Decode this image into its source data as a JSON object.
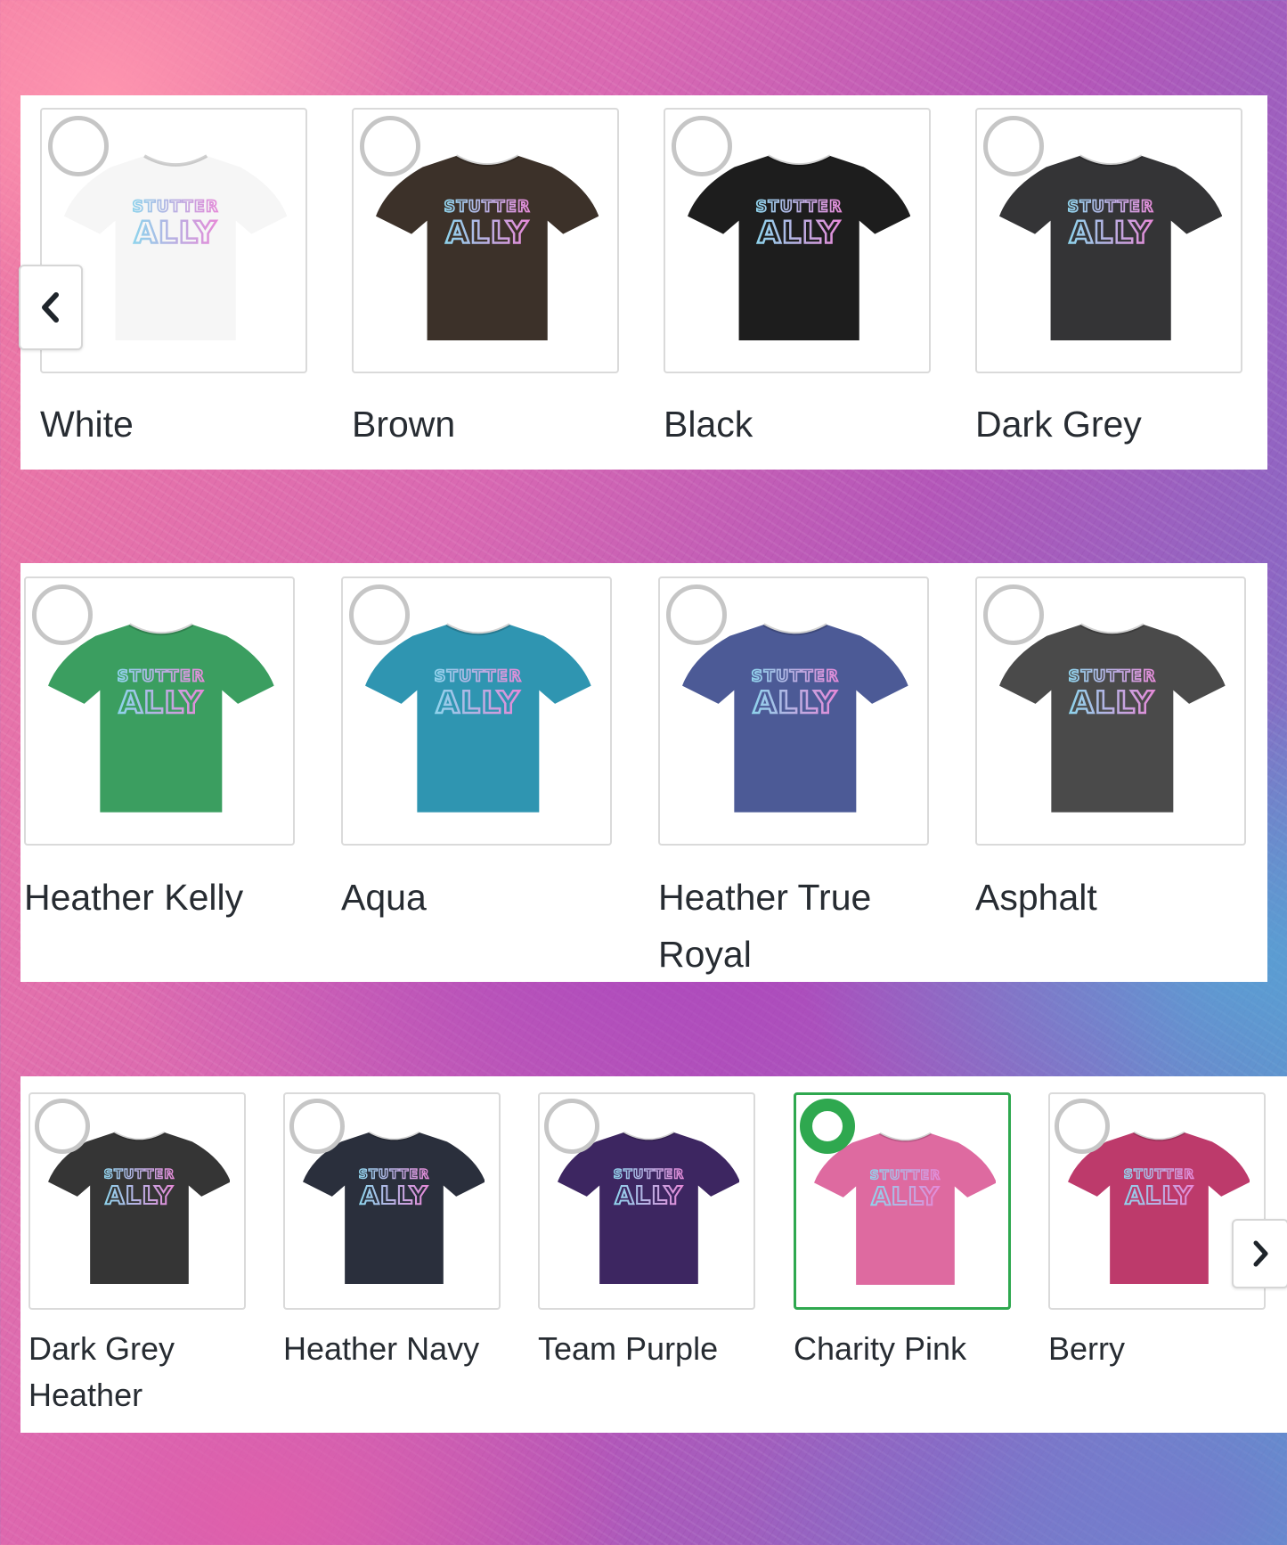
{
  "colors": {
    "selected_accent": "#2fa84f",
    "text": "#272c32",
    "print_cyan": "#8fd3ec",
    "print_pink": "#e58ad8"
  },
  "carousel": {
    "prev_icon": "chevron-left-icon",
    "next_icon": "chevron-right-icon"
  },
  "selected_color": "Charity Pink",
  "rows": [
    {
      "swatches": [
        {
          "label": "White",
          "shirt_color": "#f6f6f6",
          "print_top": "STUTTER",
          "print_main": "ALLY",
          "selected": false
        },
        {
          "label": "Brown",
          "shirt_color": "#3c3129",
          "print_top": "STUTTER",
          "print_main": "ALLY",
          "selected": false
        },
        {
          "label": "Black",
          "shirt_color": "#1d1d1d",
          "print_top": "STUTTER",
          "print_main": "ALLY",
          "selected": false
        },
        {
          "label": "Dark Grey",
          "shirt_color": "#343436",
          "print_top": "STUTTER",
          "print_main": "ALLY",
          "selected": false
        }
      ]
    },
    {
      "swatches": [
        {
          "label": "Heather Kelly",
          "shirt_color": "#3b9e60",
          "print_top": "STUTTER",
          "print_main": "ALLY",
          "selected": false
        },
        {
          "label": "Aqua",
          "shirt_color": "#2f95b1",
          "print_top": "STUTTER",
          "print_main": "ALLY",
          "selected": false
        },
        {
          "label": "Heather True Royal",
          "shirt_color": "#4c5a96",
          "print_top": "STUTTER",
          "print_main": "ALLY",
          "selected": false
        },
        {
          "label": "Asphalt",
          "shirt_color": "#4a4a4a",
          "print_top": "STUTTER",
          "print_main": "ALLY",
          "selected": false
        }
      ]
    },
    {
      "swatches": [
        {
          "label": "Dark Grey Heather",
          "shirt_color": "#353535",
          "print_top": "STUTTER",
          "print_main": "ALLY",
          "selected": false
        },
        {
          "label": "Heather Navy",
          "shirt_color": "#2a2f3c",
          "print_top": "STUTTER",
          "print_main": "ALLY",
          "selected": false
        },
        {
          "label": "Team Purple",
          "shirt_color": "#3d2661",
          "print_top": "STUTTER",
          "print_main": "ALLY",
          "selected": false
        },
        {
          "label": "Charity Pink",
          "shirt_color": "#de6aa0",
          "print_top": "STUTTER",
          "print_main": "ALLY",
          "selected": true
        },
        {
          "label": "Berry",
          "shirt_color": "#bd3a6b",
          "print_top": "STUTTER",
          "print_main": "ALLY",
          "selected": false
        }
      ]
    }
  ]
}
